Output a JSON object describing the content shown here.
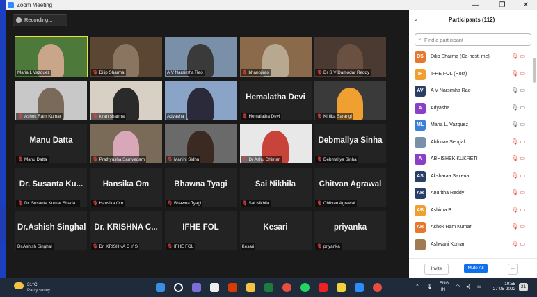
{
  "window": {
    "title": "Zoom Meeting",
    "minimize": "—",
    "maximize": "❐",
    "close": "✕"
  },
  "recording": {
    "label": "Recording..."
  },
  "tiles": [
    {
      "label": "Maria L Vazquez",
      "muted": false,
      "video": true
    },
    {
      "label": "Dilip Sharma",
      "muted": true,
      "video": true
    },
    {
      "label": "A V Narsimha Rao",
      "muted": false,
      "video": true
    },
    {
      "label": "bhanojirao",
      "muted": true,
      "video": true
    },
    {
      "label": "Dr S V Damodar Reddy",
      "muted": true,
      "video": true
    },
    {
      "label": "Ashok Ram Kumar",
      "muted": true,
      "video": true
    },
    {
      "label": "kiran sharma",
      "muted": true,
      "video": true
    },
    {
      "label": "Adyasha",
      "muted": false,
      "video": true
    },
    {
      "label": "Hemalatha Devi",
      "muted": true,
      "video": false,
      "name": "Hemalatha Devi"
    },
    {
      "label": "Kirtika Sarangi",
      "muted": true,
      "video": true
    },
    {
      "label": "Manu Datta",
      "muted": true,
      "video": false,
      "name": "Manu Datta"
    },
    {
      "label": "Prathyusha Samvedam",
      "muted": true,
      "video": true
    },
    {
      "label": "Manini Sidhu",
      "muted": true,
      "video": true
    },
    {
      "label": "Dr Ashu Dhiman",
      "muted": true,
      "video": true
    },
    {
      "label": "Debmallya Sinha",
      "muted": true,
      "video": false,
      "name": "Debmallya Sinha"
    },
    {
      "label": "Dr. Susanta Kumar Shada...",
      "muted": true,
      "video": false,
      "name": "Dr. Susanta Ku..."
    },
    {
      "label": "Hansika Om",
      "muted": true,
      "video": false,
      "name": "Hansika Om"
    },
    {
      "label": "Bhawna Tyagi",
      "muted": true,
      "video": false,
      "name": "Bhawna Tyagi"
    },
    {
      "label": "Sai Nikhila",
      "muted": true,
      "video": false,
      "name": "Sai Nikhila"
    },
    {
      "label": "Chitvan Agrawal",
      "muted": true,
      "video": false,
      "name": "Chitvan Agrawal"
    },
    {
      "label": "Dr.Ashish Singhal",
      "muted": false,
      "video": false,
      "name": "Dr.Ashish Singhal"
    },
    {
      "label": "Dr. KRISHNA C Y S",
      "muted": true,
      "video": false,
      "name": "Dr. KRISHNA C..."
    },
    {
      "label": "IFHE FOL",
      "muted": true,
      "video": false,
      "name": "IFHE FOL"
    },
    {
      "label": "Kesari",
      "muted": false,
      "video": false,
      "name": "Kesari"
    },
    {
      "label": "priyanka",
      "muted": true,
      "video": false,
      "name": "priyanka"
    }
  ],
  "participants": {
    "title": "Participants (112)",
    "search_placeholder": "Find a participant",
    "items": [
      {
        "initials": "DS",
        "name": "Dilip Sharma (Co-host, me)",
        "color": "#e8772e",
        "icons": "☁ 🎙 ▭",
        "muted": true
      },
      {
        "initials": "IF",
        "name": "IFHE FOL (Host)",
        "color": "#f0a030",
        "icons": "☁ 🎙",
        "muted": true
      },
      {
        "initials": "AV",
        "name": "A V Narsimha Rao",
        "color": "#2a3f66",
        "icons": "🎙 ▭",
        "muted": false
      },
      {
        "initials": "A",
        "name": "Adyasha",
        "color": "#8a3fc4",
        "icons": "🎙 ▭",
        "muted": false
      },
      {
        "initials": "ML",
        "name": "Maria L. Vazquez",
        "color": "#3a7fd8",
        "icons": "🎙 ▭",
        "muted": false
      },
      {
        "initials": "",
        "name": "Abhinav Sehgal",
        "color": "#7a8fa8",
        "icons": "🎙 ▭",
        "muted": true
      },
      {
        "initials": "A",
        "name": "ABHISHEK KUKRETI",
        "color": "#8a3fc4",
        "icons": "🎙 ▭",
        "muted": true
      },
      {
        "initials": "AS",
        "name": "Aksharaa Saxena",
        "color": "#2a3f66",
        "icons": "🎙 ▭",
        "muted": true
      },
      {
        "initials": "AR",
        "name": "Anuritha Reddy",
        "color": "#2a3f66",
        "icons": "🎙 ▭",
        "muted": true
      },
      {
        "initials": "AB",
        "name": "Ashima B",
        "color": "#f0a030",
        "icons": "🎙 ▭",
        "muted": true
      },
      {
        "initials": "AR",
        "name": "Ashok Ram Kumar",
        "color": "#e8772e",
        "icons": "🎙 ▭",
        "muted": true
      },
      {
        "initials": "",
        "name": "Ashwani Kumar",
        "color": "#a07a50",
        "icons": "🎙 ▭",
        "muted": true
      }
    ],
    "invite": "Invite",
    "mute_all": "Mute All",
    "more": "..."
  },
  "taskbar": {
    "temp": "31°C",
    "weather": "Partly sunny",
    "lang": "ENG",
    "region": "IN",
    "time": "10:55",
    "date": "27-05-2022",
    "notifications": "21"
  }
}
